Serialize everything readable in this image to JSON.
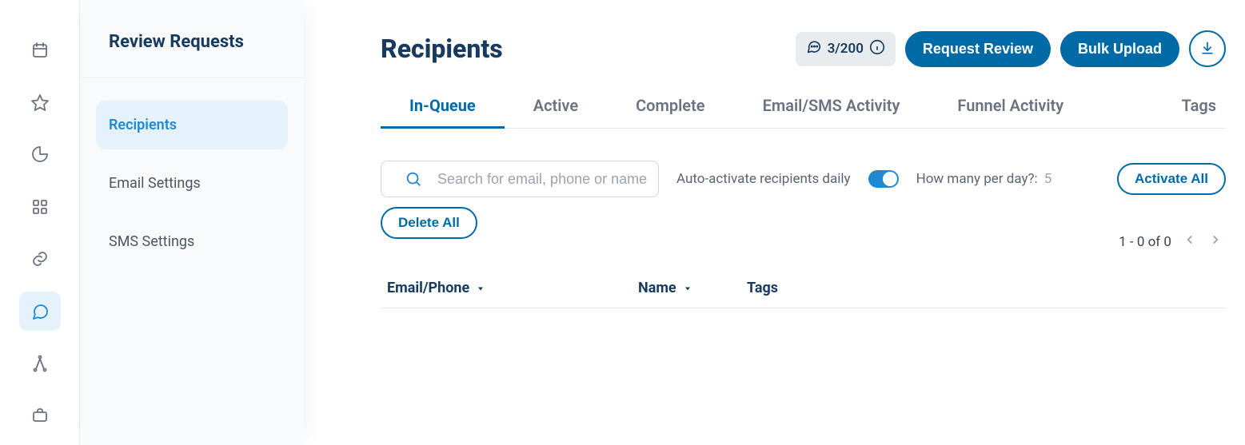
{
  "sidebar": {
    "title": "Review Requests",
    "items": [
      {
        "label": "Recipients",
        "active": true
      },
      {
        "label": "Email Settings",
        "active": false
      },
      {
        "label": "SMS Settings",
        "active": false
      }
    ]
  },
  "page": {
    "title": "Recipients"
  },
  "header": {
    "quota_chip": "3/200",
    "request_review_label": "Request Review",
    "bulk_upload_label": "Bulk Upload"
  },
  "tabs": [
    {
      "label": "In-Queue",
      "active": true
    },
    {
      "label": "Active",
      "active": false
    },
    {
      "label": "Complete",
      "active": false
    },
    {
      "label": "Email/SMS Activity",
      "active": false
    },
    {
      "label": "Funnel Activity",
      "active": false
    },
    {
      "label": "Tags",
      "active": false
    }
  ],
  "controls": {
    "search_placeholder": "Search for email, phone or name",
    "auto_activate_label": "Auto-activate recipients daily",
    "auto_activate_on": true,
    "per_day_label": "How many per day?:",
    "per_day_value": "5",
    "activate_all_label": "Activate All",
    "delete_all_label": "Delete All"
  },
  "pagination": {
    "label": "1 - 0 of 0"
  },
  "columns": {
    "email": "Email/Phone",
    "name": "Name",
    "tags": "Tags"
  }
}
